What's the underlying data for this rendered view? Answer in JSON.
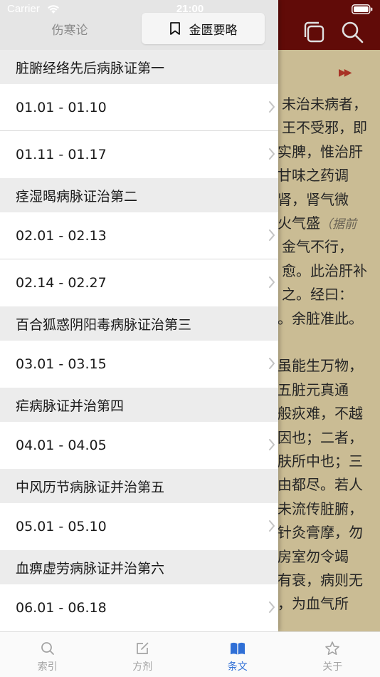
{
  "status_bar": {
    "carrier": "Carrier",
    "time": "21:00"
  },
  "drawer": {
    "segments": {
      "left_label": "伤寒论",
      "right_label": "金匮要略",
      "right_icon": "bookmark-icon"
    },
    "sections": [
      {
        "title": "脏腑经络先后病脉证第一",
        "rows": [
          "01.01 - 01.10",
          "01.11 - 01.17"
        ]
      },
      {
        "title": "痉湿暍病脉证治第二",
        "rows": [
          "02.01 - 02.13",
          "02.14 - 02.27"
        ]
      },
      {
        "title": "百合狐惑阴阳毒病脉证治第三",
        "rows": [
          "03.01 - 03.15"
        ]
      },
      {
        "title": "疟病脉证并治第四",
        "rows": [
          "04.01 - 04.05"
        ]
      },
      {
        "title": "中风历节病脉证并治第五",
        "rows": [
          "05.01 - 05.10"
        ]
      },
      {
        "title": "血痹虚劳病脉证并治第六",
        "rows": [
          "06.01 - 06.18"
        ]
      }
    ]
  },
  "background_page": {
    "header_icons": [
      "copy-icon",
      "search-icon"
    ],
    "lines": [
      "未治未病者，",
      "王不受邪，即",
      "实脾，惟治肝",
      "甘味之药调",
      "肾，肾气微",
      "火气盛",
      "金气不行，",
      "愈。此治肝补",
      "之。经曰：",
      "。余脏准此。",
      "",
      "虽能生万物，",
      "五脏元真通",
      "般疢难，不越",
      "因也；二者，",
      "肤所中也；三",
      "由都尽。若人",
      "未流传脏腑，",
      "针灸膏摩，勿",
      "房室勿令竭",
      "有衰，病则无",
      "，为血气所"
    ],
    "note": "（据前"
  },
  "tabbar": {
    "tabs": [
      {
        "label": "索引",
        "icon": "search-icon",
        "active": false
      },
      {
        "label": "方剂",
        "icon": "edit-icon",
        "active": false
      },
      {
        "label": "条文",
        "icon": "book-icon",
        "active": true
      },
      {
        "label": "关于",
        "icon": "star-icon",
        "active": false
      }
    ]
  },
  "colors": {
    "header_red": "#6f0d0a",
    "page_beige": "#e6d7a9",
    "active_tab": "#2f6fd6",
    "inactive_tab": "#a3a3a3",
    "section_gray": "#ececec"
  }
}
